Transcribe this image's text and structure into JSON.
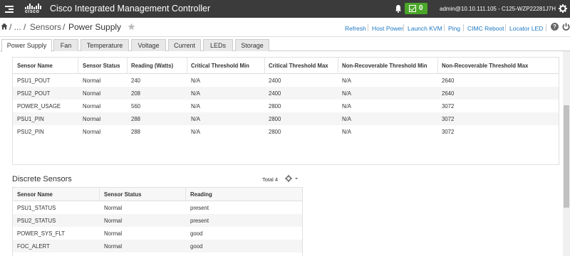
{
  "app": {
    "title": "Cisco Integrated Management Controller",
    "logo_text": "cisco",
    "alert_count": "0",
    "user": "admin@10.10.111.105 - C125-WZP22281J7H"
  },
  "breadcrumb": {
    "ellipsis": "/ ... /",
    "parent": "Sensors",
    "divider": "/",
    "current": "Power Supply"
  },
  "actions": [
    "Refresh",
    "Host Power",
    "Launch KVM",
    "Ping",
    "CIMC Reboot",
    "Locator LED"
  ],
  "help_label": "?",
  "tabs": [
    "Power Supply",
    "Fan",
    "Temperature",
    "Voltage",
    "Current",
    "LEDs",
    "Storage"
  ],
  "active_tab": "Power Supply",
  "threshold_table": {
    "columns": [
      "Sensor Name",
      "Sensor Status",
      "Reading (Watts)",
      "Critical Threshold Min",
      "Critical Threshold Max",
      "Non-Recoverable Threshold Min",
      "Non-Recoverable Threshold Max"
    ],
    "rows": [
      [
        "PSU1_POUT",
        "Normal",
        "240",
        "N/A",
        "2400",
        "N/A",
        "2640"
      ],
      [
        "PSU2_POUT",
        "Normal",
        "208",
        "N/A",
        "2400",
        "N/A",
        "2640"
      ],
      [
        "POWER_USAGE",
        "Normal",
        "560",
        "N/A",
        "2800",
        "N/A",
        "3072"
      ],
      [
        "PSU1_PIN",
        "Normal",
        "288",
        "N/A",
        "2800",
        "N/A",
        "3072"
      ],
      [
        "PSU2_PIN",
        "Normal",
        "288",
        "N/A",
        "2800",
        "N/A",
        "3072"
      ]
    ]
  },
  "discrete": {
    "title": "Discrete Sensors",
    "total": "Total 4",
    "columns": [
      "Sensor Name",
      "Sensor Status",
      "Reading"
    ],
    "rows": [
      [
        "PSU1_STATUS",
        "Normal",
        "present"
      ],
      [
        "PSU2_STATUS",
        "Normal",
        "present"
      ],
      [
        "POWER_SYS_FLT",
        "Normal",
        "good"
      ],
      [
        "FOC_ALERT",
        "Normal",
        "good"
      ]
    ]
  },
  "colors": {
    "topbar": "#3b3b3b",
    "accent_link": "#1e78c2",
    "alert_badge": "#4aa629"
  }
}
